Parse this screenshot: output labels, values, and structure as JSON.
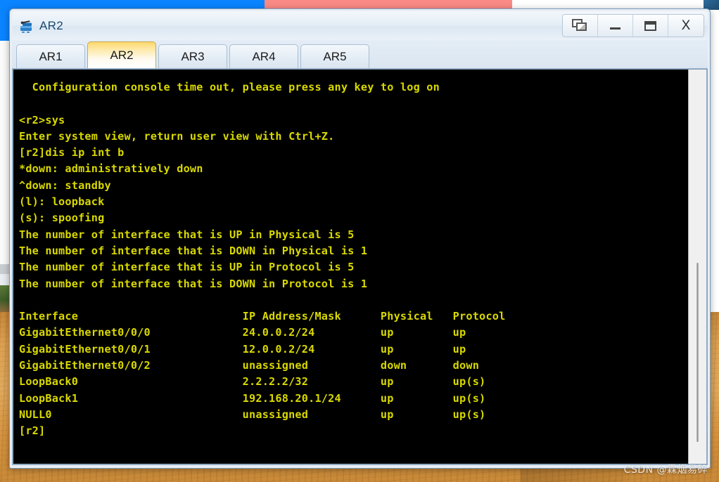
{
  "window": {
    "title": "AR2",
    "icon": "router-icon",
    "controls": [
      {
        "name": "cascade-windows-button",
        "label": "",
        "icon": "cascade-windows-icon"
      },
      {
        "name": "minimize-button",
        "label": "",
        "icon": "minimize-icon"
      },
      {
        "name": "maximize-button",
        "label": "",
        "icon": "maximize-icon"
      },
      {
        "name": "close-button",
        "label": "X",
        "icon": "close-icon"
      }
    ]
  },
  "tabs": {
    "items": [
      {
        "label": "AR1",
        "active": false
      },
      {
        "label": "AR2",
        "active": true
      },
      {
        "label": "AR3",
        "active": false
      },
      {
        "label": "AR4",
        "active": false
      },
      {
        "label": "AR5",
        "active": false
      }
    ],
    "active_index": 1
  },
  "console": {
    "background_color": "#000000",
    "text_color": "#d9d900",
    "lines": [
      "  Configuration console time out, please press any key to log on",
      "",
      "<r2>sys",
      "Enter system view, return user view with Ctrl+Z.",
      "[r2]dis ip int b",
      "*down: administratively down",
      "^down: standby",
      "(l): loopback",
      "(s): spoofing",
      "The number of interface that is UP in Physical is 5",
      "The number of interface that is DOWN in Physical is 1",
      "The number of interface that is UP in Protocol is 5",
      "The number of interface that is DOWN in Protocol is 1",
      "",
      "Interface                         IP Address/Mask      Physical   Protocol",
      "GigabitEthernet0/0/0              24.0.0.2/24          up         up",
      "GigabitEthernet0/0/1              12.0.0.2/24          up         up",
      "GigabitEthernet0/0/2              unassigned           down       down",
      "LoopBack0                         2.2.2.2/32           up         up(s)",
      "LoopBack1                         192.168.20.1/24      up         up(s)",
      "NULL0                             unassigned           up         up(s)",
      "[r2]"
    ],
    "interface_table": {
      "headers": [
        "Interface",
        "IP Address/Mask",
        "Physical",
        "Protocol"
      ],
      "rows": [
        [
          "GigabitEthernet0/0/0",
          "24.0.0.2/24",
          "up",
          "up"
        ],
        [
          "GigabitEthernet0/0/1",
          "12.0.0.2/24",
          "up",
          "up"
        ],
        [
          "GigabitEthernet0/0/2",
          "unassigned",
          "down",
          "down"
        ],
        [
          "LoopBack0",
          "2.2.2.2/32",
          "up",
          "up(s)"
        ],
        [
          "LoopBack1",
          "192.168.20.1/24",
          "up",
          "up(s)"
        ],
        [
          "NULL0",
          "unassigned",
          "up",
          "up(s)"
        ]
      ]
    },
    "counters": {
      "up_physical": "5",
      "down_physical": "1",
      "up_protocol": "5",
      "down_protocol": "1"
    },
    "prompt": "[r2]"
  },
  "watermark": {
    "text": "CSDN @霖烟易碎"
  }
}
